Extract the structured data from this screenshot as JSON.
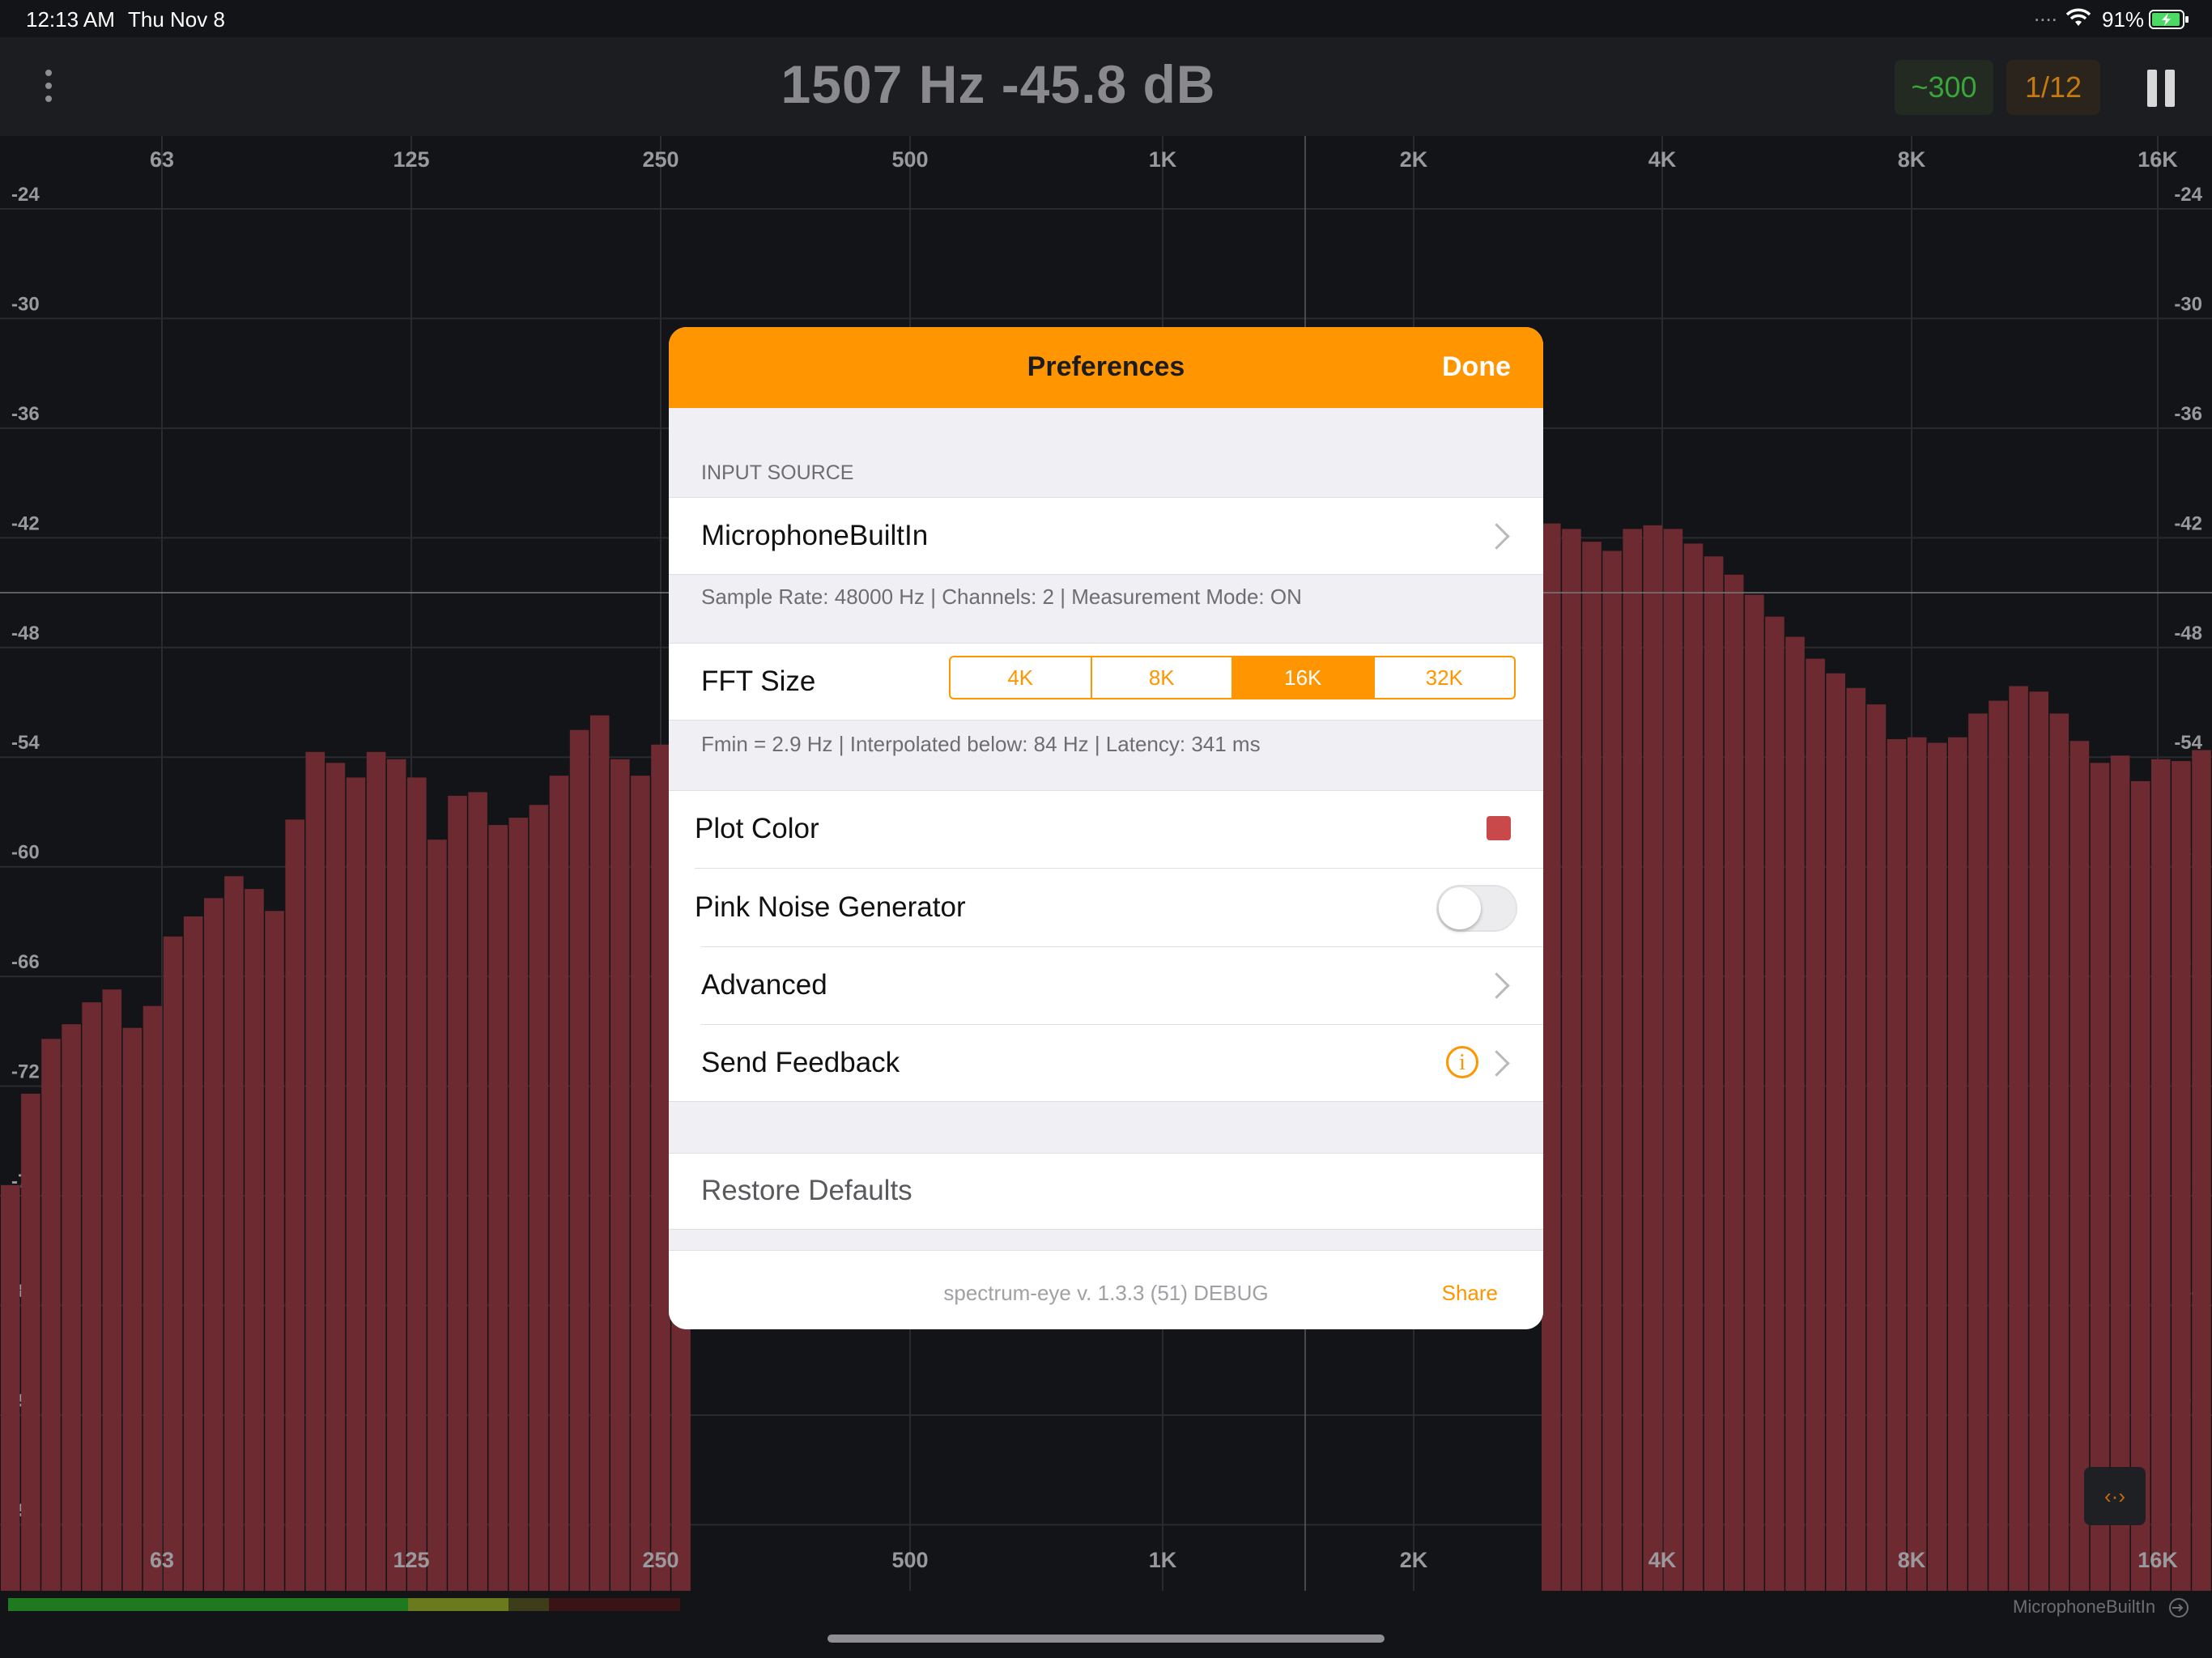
{
  "status_bar": {
    "time": "12:13 AM",
    "date": "Thu Nov 8",
    "signal": "....",
    "battery": "91%",
    "wifi_icon": "wifi-icon",
    "battery_icon": "battery-charging-icon"
  },
  "toolbar": {
    "readout": "1507 Hz -45.8 dB",
    "averaging": "~300",
    "octave": "1/12",
    "menu_icon": "more-vertical-icon",
    "pause_icon": "pause-icon"
  },
  "chart_data": {
    "type": "bar",
    "xlabel": "",
    "ylabel": "",
    "x_ticks": [
      "63",
      "125",
      "250",
      "500",
      "1K",
      "2K",
      "4K",
      "8K",
      "16K"
    ],
    "y_ticks": [
      "-24",
      "-30",
      "-36",
      "-42",
      "-48",
      "-54",
      "-60",
      "-66",
      "-72",
      "-78",
      "-84",
      "-90",
      "-96"
    ],
    "ylim": [
      -100.5,
      -20.9
    ],
    "bar_color": "#6e2a31",
    "cursor_db": -45.8,
    "cursor_hz": 1507,
    "left_bars_db": [
      -78.3,
      -73.3,
      -70.3,
      -69.5,
      -68.3,
      -67.6,
      -69.7,
      -68.5,
      -64.7,
      -63.6,
      -62.6,
      -61.4,
      -62.1,
      -63.3,
      -58.3,
      -54.6,
      -55.2,
      -56.0,
      -54.6,
      -55.0,
      -56.0,
      -59.4,
      -57.0,
      -56.8,
      -58.6,
      -58.2,
      -57.5,
      -55.9,
      -53.4,
      -52.6,
      -55.0,
      -55.9,
      -54.2,
      -54.2
    ],
    "right_bars_db": [
      -42.1,
      -42.4,
      -43.1,
      -43.6,
      -42.4,
      -42.2,
      -42.4,
      -43.2,
      -43.9,
      -44.9,
      -46.0,
      -47.2,
      -48.3,
      -49.5,
      -50.3,
      -51.1,
      -52.0,
      -53.9,
      -53.8,
      -54.1,
      -53.8,
      -52.5,
      -51.8,
      -51.0,
      -51.3,
      -52.5,
      -54.0,
      -55.2,
      -54.8,
      -56.2,
      -55.0,
      -55.1,
      -54.5,
      -53.6,
      -53.6,
      -54.5,
      -52.6,
      -52.4,
      -52.1,
      -53.2
    ]
  },
  "modal": {
    "title": "Preferences",
    "done": "Done",
    "input_source_header": "INPUT SOURCE",
    "input_source": "MicrophoneBuiltIn",
    "input_info": "Sample Rate: 48000 Hz | Channels: 2 | Measurement Mode: ON",
    "fft_label": "FFT Size",
    "fft_options": [
      "4K",
      "8K",
      "16K",
      "32K"
    ],
    "fft_selected": "16K",
    "fft_info": "Fmin = 2.9 Hz  |  Interpolated below: 84 Hz  |  Latency: 341 ms",
    "plot_color_label": "Plot Color",
    "plot_color": "#c9494b",
    "pink_noise_label": "Pink Noise Generator",
    "pink_noise_on": false,
    "advanced_label": "Advanced",
    "feedback_label": "Send Feedback",
    "feedback_icon": "info-icon",
    "restore_label": "Restore Defaults",
    "version": "spectrum-eye v. 1.3.3 (51) DEBUG",
    "share": "Share"
  },
  "bottom": {
    "source": "MicrophoneBuiltIn",
    "source_icon": "input-icon",
    "expand_icon": "code-icon",
    "expand_glyph": "‹·›"
  }
}
